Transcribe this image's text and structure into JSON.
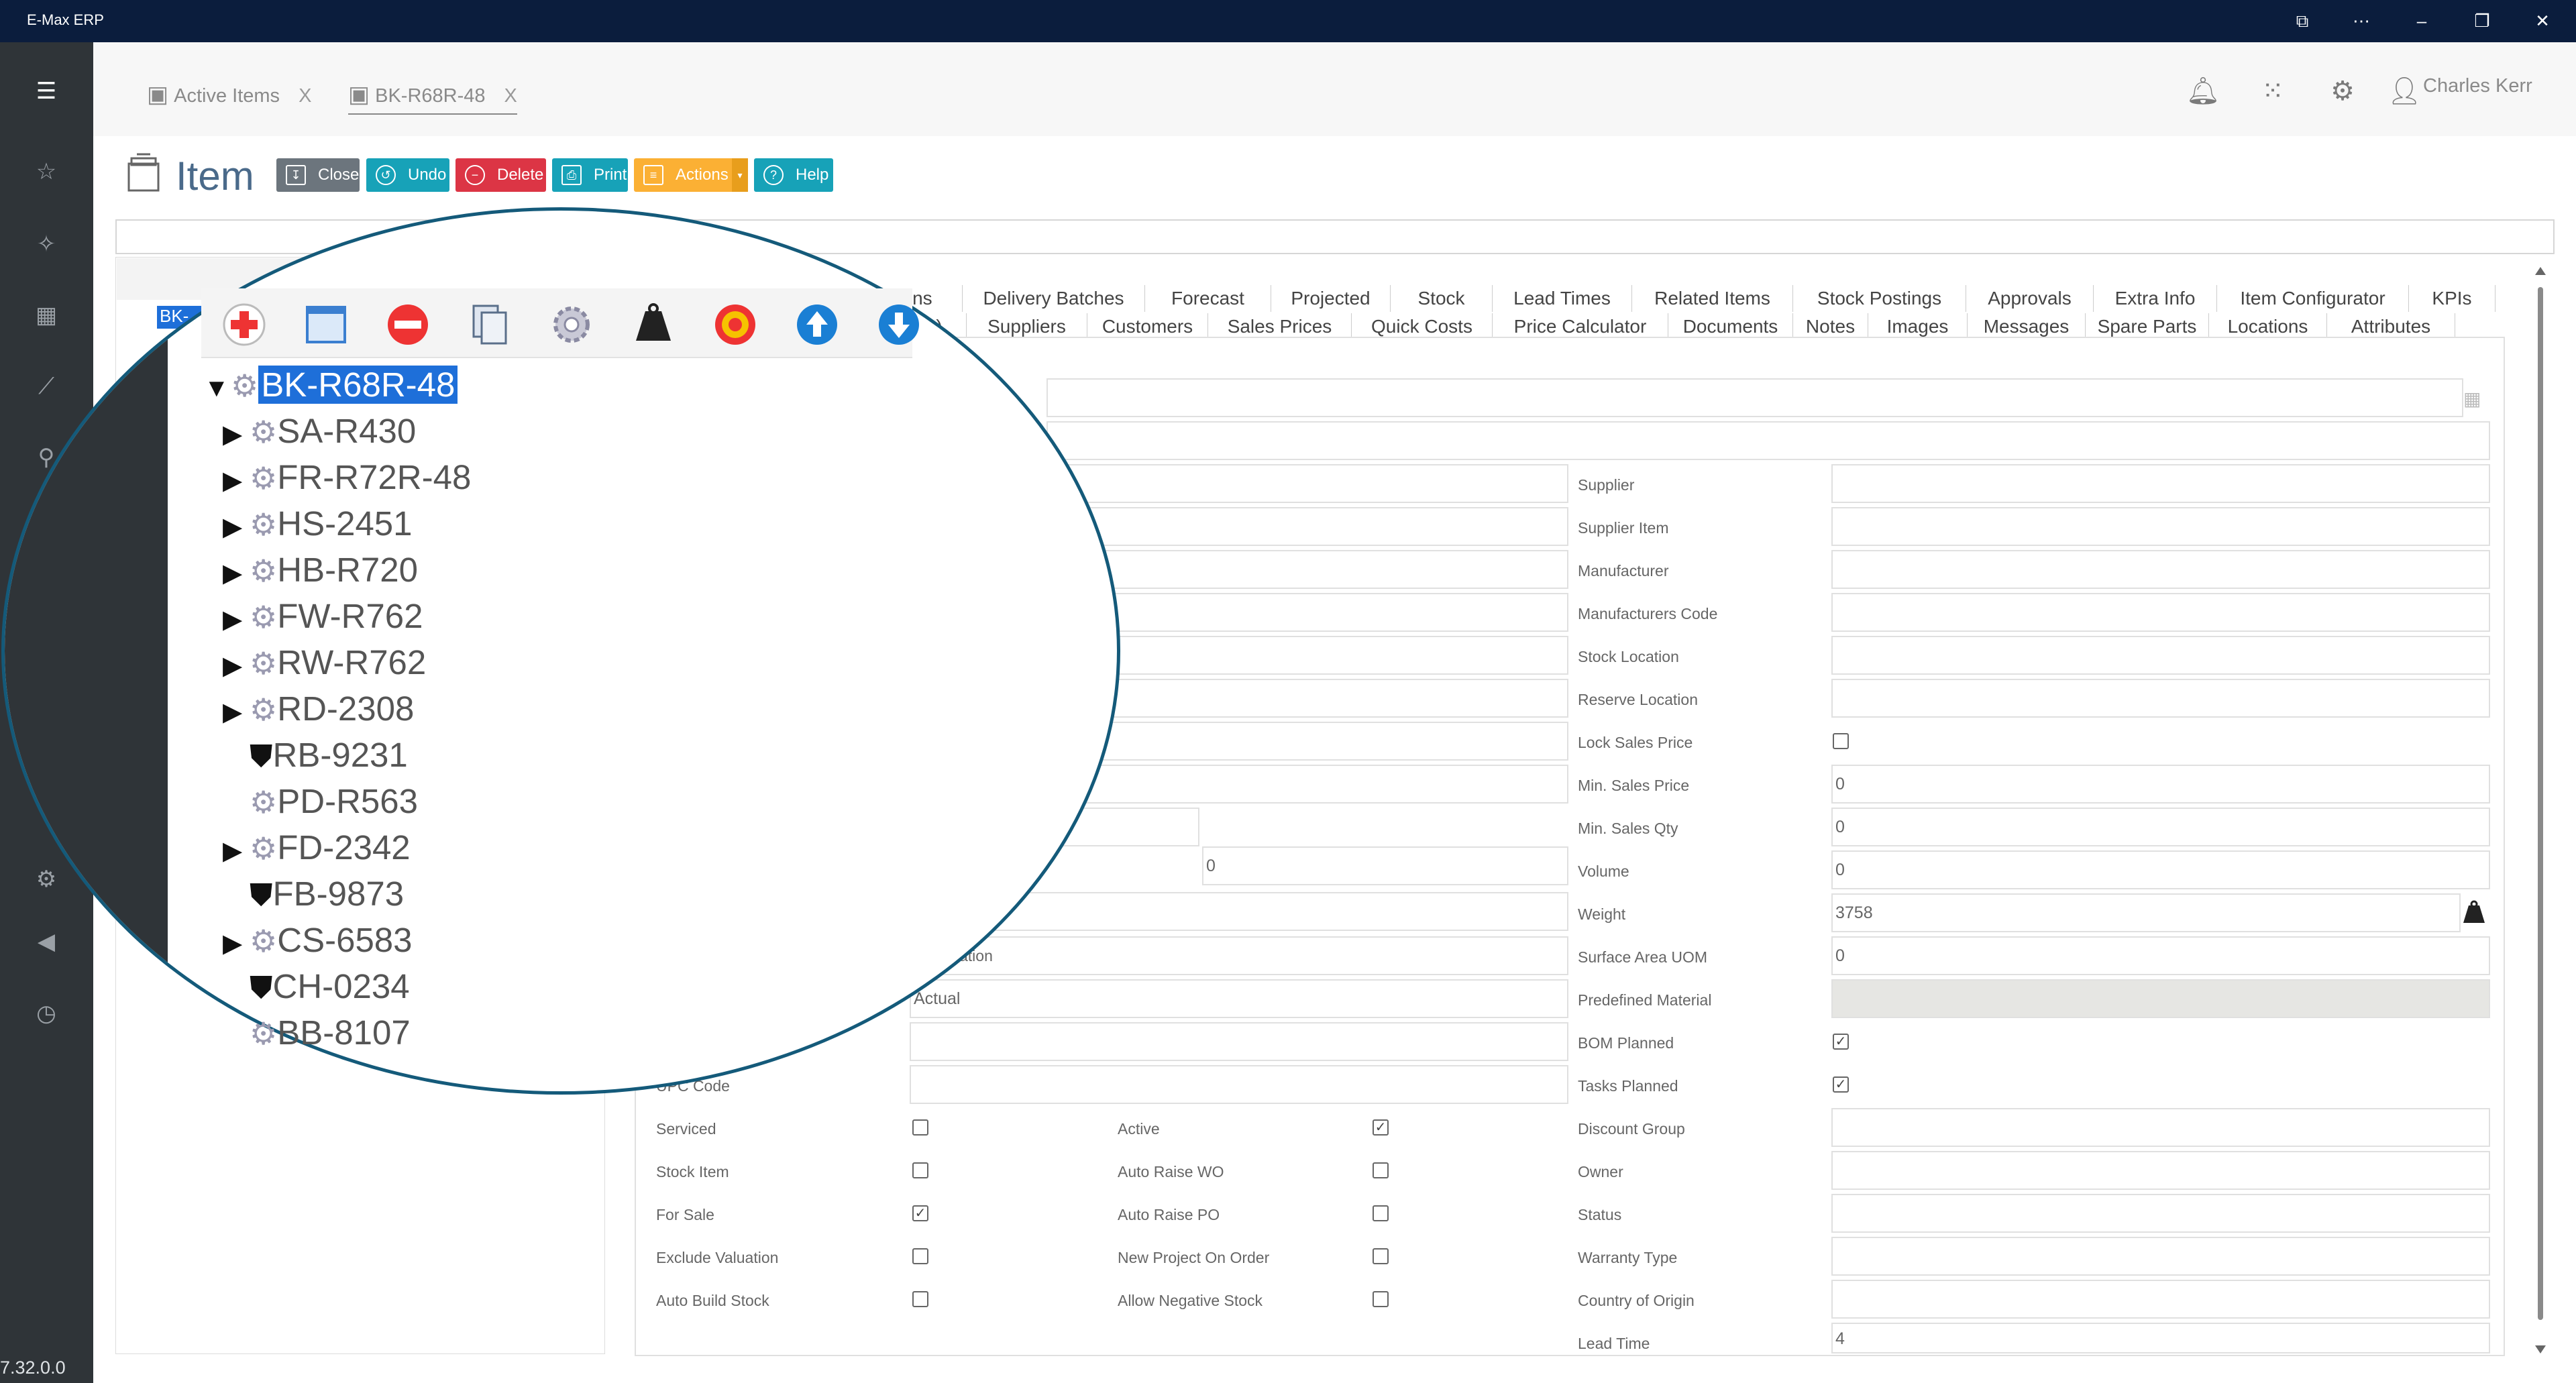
{
  "window": {
    "title": "E-Max ERP",
    "version": "7.32.0.0"
  },
  "tabs": [
    {
      "label": "Active Items",
      "close": "X"
    },
    {
      "label": "BK-R68R-48",
      "close": "X"
    }
  ],
  "header": {
    "user": "Charles Kerr"
  },
  "page": {
    "title": "Item",
    "buttons": [
      {
        "label": "Close",
        "color": "#6c757d"
      },
      {
        "label": "Undo",
        "color": "#17a2b8"
      },
      {
        "label": "Delete",
        "color": "#dc3545"
      },
      {
        "label": "Print",
        "color": "#17a2b8"
      },
      {
        "label": "Actions",
        "color": "#fbb034"
      },
      {
        "label": "Help",
        "color": "#17a2b8"
      }
    ]
  },
  "form_tabs_row1": [
    "Delivery Batches",
    "Forecast",
    "Projected",
    "Stock",
    "Lead Times",
    "Related Items",
    "Stock Postings",
    "Approvals",
    "Extra Info",
    "Item Configurator",
    "KPIs"
  ],
  "form_tabs_row2": [
    "Suppliers",
    "Customers",
    "Sales Prices",
    "Quick Costs",
    "Price Calculator",
    "Documents",
    "Notes",
    "Images",
    "Messages",
    "Spare Parts",
    "Locations",
    "Attributes"
  ],
  "partial_tab_text": {
    "row1": "ions",
    "row2": ")"
  },
  "right_fields": [
    {
      "label": "Supplier",
      "value": ""
    },
    {
      "label": "Supplier Item",
      "value": ""
    },
    {
      "label": "Manufacturer",
      "value": ""
    },
    {
      "label": "Manufacturers Code",
      "value": ""
    },
    {
      "label": "Stock Location",
      "value": ""
    },
    {
      "label": "Reserve Location",
      "value": ""
    },
    {
      "label": "Lock Sales Price",
      "checkbox": false
    },
    {
      "label": "Min. Sales Price",
      "value": "0"
    },
    {
      "label": "Min. Sales Qty",
      "value": "0"
    },
    {
      "label": "Volume",
      "value": "0"
    },
    {
      "label": "Weight",
      "value": "3758"
    },
    {
      "label": "Surface Area UOM",
      "value": "0"
    },
    {
      "label": "Predefined Material",
      "value": ""
    },
    {
      "label": "BOM Planned",
      "checkbox": true
    },
    {
      "label": "Tasks Planned",
      "checkbox": true
    },
    {
      "label": "Discount Group",
      "value": ""
    },
    {
      "label": "Owner",
      "value": ""
    },
    {
      "label": "Status",
      "value": ""
    },
    {
      "label": "Warranty Type",
      "value": ""
    },
    {
      "label": "Country of Origin",
      "value": ""
    },
    {
      "label": "Lead Time",
      "value": "4"
    }
  ],
  "middle_partial": {
    "field_zero": "0",
    "ation_label": "ation",
    "actual_value": "Actual",
    "upc_label": "UPC Code"
  },
  "checkbox_col1": [
    {
      "label": "Serviced",
      "checked": false
    },
    {
      "label": "Stock Item",
      "checked": false
    },
    {
      "label": "For Sale",
      "checked": true
    },
    {
      "label": "Exclude Valuation",
      "checked": false
    },
    {
      "label": "Auto Build Stock",
      "checked": false
    }
  ],
  "checkbox_col2": [
    {
      "label": "Active",
      "checked": true
    },
    {
      "label": "Auto Raise WO",
      "checked": false
    },
    {
      "label": "Auto Raise PO",
      "checked": false
    },
    {
      "label": "New Project On Order",
      "checked": false
    },
    {
      "label": "Allow Negative Stock",
      "checked": false
    }
  ],
  "tree": {
    "behind_label": "BK-",
    "root": "BK-R68R-48",
    "children": [
      {
        "label": "SA-R430",
        "expandable": true,
        "icon": "gear-icon"
      },
      {
        "label": "FR-R72R-48",
        "expandable": true,
        "icon": "gear-icon"
      },
      {
        "label": "HS-2451",
        "expandable": true,
        "icon": "gear-icon"
      },
      {
        "label": "HB-R720",
        "expandable": true,
        "icon": "gear-icon"
      },
      {
        "label": "FW-R762",
        "expandable": true,
        "icon": "gear-icon"
      },
      {
        "label": "RW-R762",
        "expandable": true,
        "icon": "gear-icon"
      },
      {
        "label": "RD-2308",
        "expandable": true,
        "icon": "gear-icon"
      },
      {
        "label": "RB-9231",
        "expandable": false,
        "icon": "weight-icon"
      },
      {
        "label": "PD-R563",
        "expandable": false,
        "icon": "gear-icon"
      },
      {
        "label": "FD-2342",
        "expandable": true,
        "icon": "gear-icon"
      },
      {
        "label": "FB-9873",
        "expandable": false,
        "icon": "weight-icon"
      },
      {
        "label": "CS-6583",
        "expandable": true,
        "icon": "gear-icon"
      },
      {
        "label": "CH-0234",
        "expandable": false,
        "icon": "weight-icon"
      },
      {
        "label": "BB-8107",
        "expandable": false,
        "icon": "gear-icon"
      }
    ]
  },
  "colors": {
    "titlebar": "#0b1d3d",
    "sidebar": "#2f3438",
    "selection": "#1e6fd9",
    "zoom_border": "#145a7a"
  }
}
